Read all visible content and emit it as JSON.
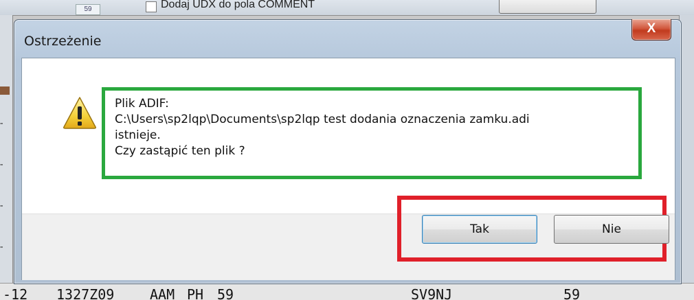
{
  "background": {
    "checkbox_label": "Dodaj UDX do pola COMMENT",
    "field_value": "59",
    "bottom_row": [
      "-12",
      "1327Z09",
      "AAM",
      "PH",
      "59",
      "SV9NJ",
      "59"
    ]
  },
  "dialog": {
    "title": "Ostrzeżenie",
    "close_glyph": "X",
    "icon": "warning-triangle-icon",
    "message_lines": [
      "Plik ADIF:",
      "C:\\Users\\sp2lqp\\Documents\\sp2lqp test dodania oznaczenia zamku.adi",
      "istnieje.",
      "Czy zastąpić ten plik ?"
    ],
    "buttons": {
      "yes": "Tak",
      "no": "Nie"
    }
  },
  "colors": {
    "highlight_message": "#2aa83e",
    "highlight_buttons": "#e0202a",
    "close_button": "#c13b1e"
  }
}
